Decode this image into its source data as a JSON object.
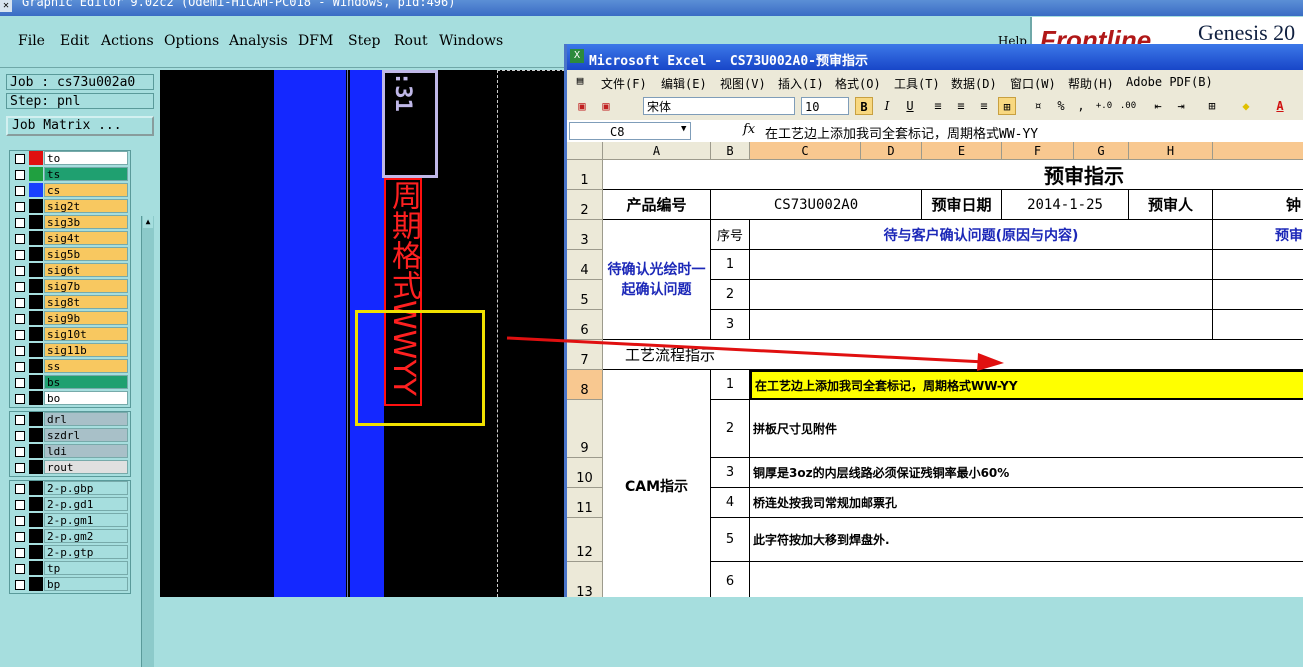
{
  "genesis": {
    "title": "Graphic Editor 9.02c2 (Odemi-HiCAM-PC018 - Windows, pid:496)",
    "menu": [
      "File",
      "Edit",
      "Actions",
      "Options",
      "Analysis",
      "DFM",
      "Step",
      "Rout",
      "Windows"
    ],
    "help": "Help",
    "brand_logo": "Frontline",
    "brand_product": "Genesis 20",
    "job": "Job : cs73u002a0",
    "step": "Step: pnl",
    "job_matrix": "Job Matrix ...",
    "layers_group1": [
      {
        "name": "to",
        "color": "#e01010",
        "bg": "#ffffff"
      },
      {
        "name": "ts",
        "color": "#20a040",
        "bg": "#1fa070"
      },
      {
        "name": "cs",
        "color": "#1840ff",
        "bg": "#f8c860"
      },
      {
        "name": "sig2t",
        "color": "#000",
        "bg": "#f8c860"
      },
      {
        "name": "sig3b",
        "color": "#000",
        "bg": "#f8c860"
      },
      {
        "name": "sig4t",
        "color": "#000",
        "bg": "#f8c860"
      },
      {
        "name": "sig5b",
        "color": "#000",
        "bg": "#f8c860"
      },
      {
        "name": "sig6t",
        "color": "#000",
        "bg": "#f8c860"
      },
      {
        "name": "sig7b",
        "color": "#000",
        "bg": "#f8c860"
      },
      {
        "name": "sig8t",
        "color": "#000",
        "bg": "#f8c860"
      },
      {
        "name": "sig9b",
        "color": "#000",
        "bg": "#f8c860"
      },
      {
        "name": "sig10t",
        "color": "#000",
        "bg": "#f8c860"
      },
      {
        "name": "sig11b",
        "color": "#000",
        "bg": "#f8c860"
      },
      {
        "name": "ss",
        "color": "#000",
        "bg": "#f8c860"
      },
      {
        "name": "bs",
        "color": "#000",
        "bg": "#1fa070"
      },
      {
        "name": "bo",
        "color": "#000",
        "bg": "#ffffff"
      }
    ],
    "layers_group2": [
      {
        "name": "drl",
        "color": "#000",
        "bg": "#a8c0c8"
      },
      {
        "name": "szdrl",
        "color": "#000",
        "bg": "#a8c0c8"
      },
      {
        "name": "ldi",
        "color": "#000",
        "bg": "#a8c0c8"
      },
      {
        "name": "rout",
        "color": "#000",
        "bg": "#e0e0e0"
      }
    ],
    "layers_group3": [
      {
        "name": "2-p.gbp",
        "color": "#000",
        "bg": "#a6dede"
      },
      {
        "name": "2-p.gd1",
        "color": "#000",
        "bg": "#a6dede"
      },
      {
        "name": "2-p.gm1",
        "color": "#000",
        "bg": "#a6dede"
      },
      {
        "name": "2-p.gm2",
        "color": "#000",
        "bg": "#a6dede"
      },
      {
        "name": "2-p.gtp",
        "color": "#000",
        "bg": "#a6dede"
      },
      {
        "name": "tp",
        "color": "#000",
        "bg": "#a6dede"
      },
      {
        "name": "bp",
        "color": "#000",
        "bg": "#a6dede"
      }
    ],
    "canvas_text_top": ":31",
    "canvas_text_red": "周期格式WWYY"
  },
  "excel": {
    "title": "Microsoft Excel - CS73U002A0-预审指示",
    "menu": [
      "文件(F)",
      "编辑(E)",
      "视图(V)",
      "插入(I)",
      "格式(O)",
      "工具(T)",
      "数据(D)",
      "窗口(W)",
      "帮助(H)",
      "Adobe PDF(B)"
    ],
    "font": "宋体",
    "font_size": "10",
    "name_box": "C8",
    "fx": "fx",
    "formula": "在工艺边上添加我司全套标记，周期格式WW-YY",
    "columns": [
      "A",
      "B",
      "C",
      "D",
      "E",
      "F",
      "G",
      "H"
    ],
    "rows": [
      "1",
      "2",
      "3",
      "4",
      "5",
      "6",
      "7",
      "8",
      "9",
      "10",
      "11",
      "12",
      "13"
    ],
    "sheet": {
      "title": "预审指示",
      "product_label": "产品编号",
      "product_value": "CS73U002A0",
      "date_label": "预审日期",
      "date_value": "2014-1-25",
      "reviewer_label": "预审人",
      "reviewer_value": "钟",
      "confirm_label": "待确认光绘时一起确认问题",
      "seq_label": "序号",
      "confirm_header": "待与客户确认问题(原因与内容)",
      "confirm_header_right": "预审",
      "confirm_seq": [
        "1",
        "2",
        "3"
      ],
      "process_label": "工艺流程指示",
      "cam_label": "CAM指示",
      "cam_items": [
        {
          "seq": "1",
          "text": "在工艺边上添加我司全套标记，周期格式WW-YY"
        },
        {
          "seq": "2",
          "text": "拼板尺寸见附件"
        },
        {
          "seq": "3",
          "text": "铜厚是3oz的内层线路必须保证残铜率最小60%"
        },
        {
          "seq": "4",
          "text": "桥连处按我司常规加邮票孔"
        },
        {
          "seq": "5",
          "text": "此字符按加大移到焊盘外."
        },
        {
          "seq": "6",
          "text": ""
        }
      ]
    }
  },
  "colors": {
    "highlight": "#ffff00",
    "annot_arrow": "#e01010",
    "annot_box": "#f0e000"
  }
}
